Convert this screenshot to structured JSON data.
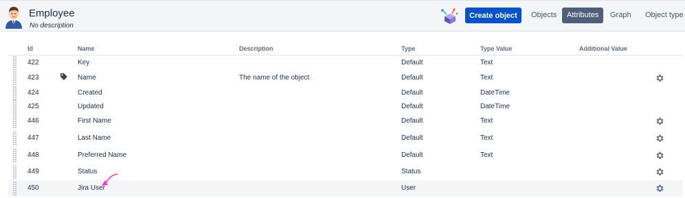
{
  "header": {
    "title": "Employee",
    "subtitle": "No description",
    "avatar_icon": "user-avatar-icon",
    "object_type_icon": "object-schema-icon",
    "create_button": "Create object",
    "nav": {
      "objects": "Objects",
      "attributes": "Attributes",
      "graph": "Graph",
      "object_type": "Object type"
    },
    "active_tab": "Attributes"
  },
  "table": {
    "columns": [
      "Id",
      "Name",
      "Description",
      "Type",
      "Type Value",
      "Additional Value"
    ],
    "rows": [
      {
        "id": "422",
        "name": "Key",
        "description": "",
        "type": "Default",
        "type_value": "Text",
        "label_icon": false,
        "config": false,
        "highlight": false
      },
      {
        "id": "423",
        "name": "Name",
        "description": "The name of the object",
        "type": "Default",
        "type_value": "Text",
        "label_icon": true,
        "config": true,
        "highlight": false
      },
      {
        "id": "424",
        "name": "Created",
        "description": "",
        "type": "Default",
        "type_value": "DateTime",
        "label_icon": false,
        "config": false,
        "highlight": false
      },
      {
        "id": "425",
        "name": "Updated",
        "description": "",
        "type": "Default",
        "type_value": "DateTime",
        "label_icon": false,
        "config": false,
        "highlight": false
      },
      {
        "id": "446",
        "name": "First Name",
        "description": "",
        "type": "Default",
        "type_value": "Text",
        "label_icon": false,
        "config": true,
        "highlight": false
      },
      {
        "id": "447",
        "name": "Last Name",
        "description": "",
        "type": "Default",
        "type_value": "Text",
        "label_icon": false,
        "config": true,
        "highlight": false
      },
      {
        "id": "448",
        "name": "Preferred Name",
        "description": "",
        "type": "Default",
        "type_value": "Text",
        "label_icon": false,
        "config": true,
        "highlight": false
      },
      {
        "id": "449",
        "name": "Status",
        "description": "",
        "type": "Status",
        "type_value": "",
        "label_icon": false,
        "config": true,
        "highlight": false
      },
      {
        "id": "450",
        "name": "Jira User",
        "description": "",
        "type": "User",
        "type_value": "",
        "label_icon": false,
        "config": true,
        "highlight": true
      }
    ]
  },
  "icons": {
    "drag_handle": "drag-handle-icon",
    "gear": "gear-icon",
    "tag": "tag-icon",
    "annotation": "pink-arrow-annotation"
  },
  "colors": {
    "primary": "#0052cc",
    "active_tab": "#505f79",
    "header_bg": "#f4f5f7",
    "annotation": "#ff33cc"
  }
}
